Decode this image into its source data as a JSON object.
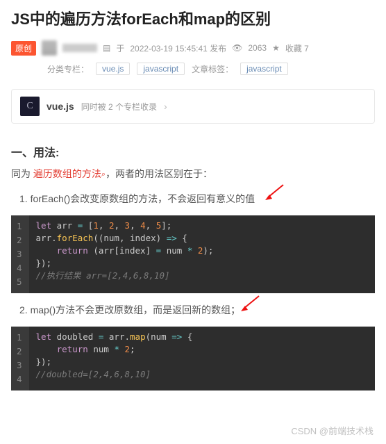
{
  "title": "JS中的遍历方法forEach和map的区别",
  "meta": {
    "badge": "原创",
    "pub_prefix": "于",
    "pub_time": "2022-03-19 15:45:41 发布",
    "views_icon": "👁",
    "views": "2063",
    "star_icon": "★",
    "collect": "收藏 7"
  },
  "tags": {
    "category_label": "分类专栏：",
    "article_label": "文章标签：",
    "cat_tags": [
      "vue.js",
      "javascript"
    ],
    "art_tags": [
      "javascript"
    ]
  },
  "collection": {
    "icon": "C",
    "name": "vue.js",
    "sub": "同时被 2 个专栏收录",
    "chev": "›"
  },
  "section": {
    "heading": "一、用法:",
    "intro_pre": "同为 ",
    "intro_link": "遍历数组的方法",
    "intro_post": "，两者的用法区别在于：",
    "item1": "1. forEach()会改变原数组的方法，不会返回有意义的值",
    "item2": "2. map()方法不会更改原数组，而是返回新的数组；"
  },
  "code1": {
    "lines": [
      1,
      2,
      3,
      4,
      5
    ],
    "l1_kw1": "let",
    "l1_var": " arr ",
    "l1_eq": "=",
    "l1_arr": " [",
    "l1_n1": "1",
    "l1_c": ", ",
    "l1_n2": "2",
    "l1_n3": "3",
    "l1_n4": "4",
    "l1_n5": "5",
    "l1_end": "];",
    "l2_obj": "arr",
    "l2_dot": ".",
    "l2_fn": "forEach",
    "l2_open": "((num, index) ",
    "l2_arrow": "=>",
    "l2_brace": " {",
    "l3_ret": "    return",
    "l3_rest": " (arr[index] ",
    "l3_eq": "=",
    "l3_rest2": " num ",
    "l3_mul": "*",
    "l3_rest3": " ",
    "l3_two": "2",
    "l3_end": ");",
    "l4": "});",
    "l5": "//执行结果 arr=[2,4,6,8,10]"
  },
  "code2": {
    "lines": [
      1,
      2,
      3,
      4
    ],
    "l1_kw": "let",
    "l1_var": " doubled ",
    "l1_eq": "=",
    "l1_sp": " arr",
    "l1_dot": ".",
    "l1_fn": "map",
    "l1_open": "(num ",
    "l1_arrow": "=>",
    "l1_brace": " {",
    "l2_ret": "    return",
    "l2_rest": " num ",
    "l2_mul": "*",
    "l2_sp": " ",
    "l2_two": "2",
    "l2_end": ";",
    "l3": "});",
    "l4": "//doubled=[2,4,6,8,10]"
  },
  "watermark": "CSDN @前端技术栈"
}
